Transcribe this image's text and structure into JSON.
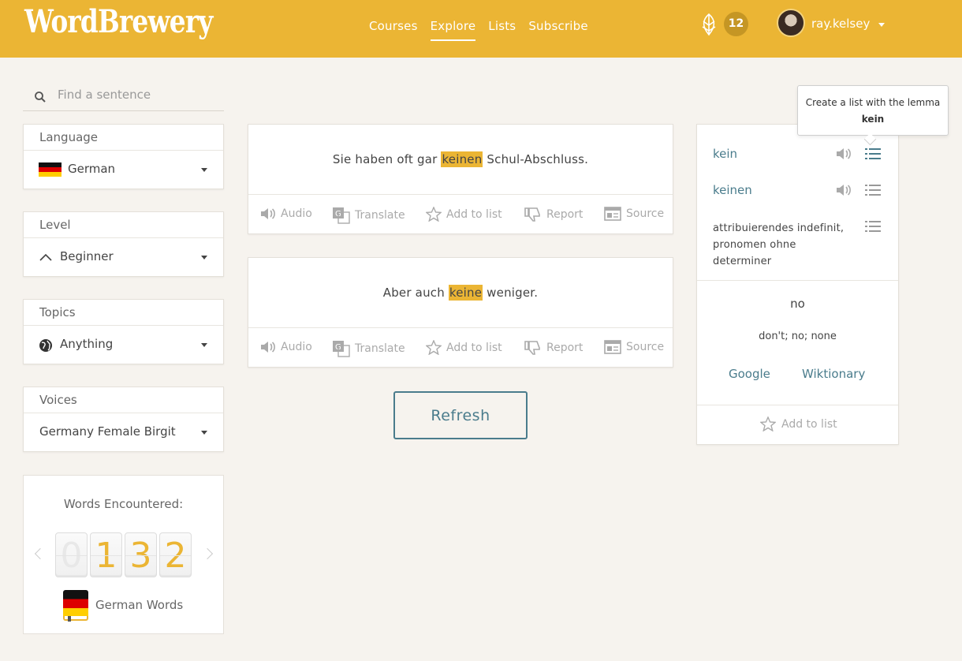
{
  "header": {
    "logo": "WordBrewery",
    "nav": [
      "Courses",
      "Explore",
      "Lists",
      "Subscribe"
    ],
    "active_nav": "Explore",
    "hops_count": "12",
    "username": "ray.kelsey"
  },
  "sidebar": {
    "search_placeholder": "Find a sentence",
    "language": {
      "title": "Language",
      "value": "German"
    },
    "level": {
      "title": "Level",
      "value": "Beginner"
    },
    "topics": {
      "title": "Topics",
      "value": "Anything"
    },
    "voices": {
      "title": "Voices",
      "value": "Germany Female Birgit"
    },
    "words": {
      "title": "Words Encountered:",
      "digits": [
        "0",
        "1",
        "3",
        "2"
      ],
      "label": "German Words"
    }
  },
  "sentences": [
    {
      "before": "Sie haben oft gar ",
      "highlight": "keinen",
      "after": " Schul-Abschluss."
    },
    {
      "before": "Aber auch ",
      "highlight": "keine",
      "after": " weniger."
    }
  ],
  "actions": {
    "audio": "Audio",
    "translate": "Translate",
    "add_to_list": "Add to list",
    "report": "Report",
    "source": "Source"
  },
  "refresh_label": "Refresh",
  "word_panel": {
    "lemma": "kein",
    "form": "keinen",
    "pos": "attribuierendes indefinit, pronomen ohne determiner",
    "gloss_word": "no",
    "gloss_def": "don't; no; none",
    "links": {
      "google": "Google",
      "wiktionary": "Wiktionary"
    },
    "add_to_list": "Add to list"
  },
  "tooltip": {
    "text": "Create a list with the lemma",
    "bold": "kein"
  },
  "colors": {
    "brand": "#ebb534",
    "accent": "#4a7c8c",
    "background": "#f6f3ee"
  }
}
